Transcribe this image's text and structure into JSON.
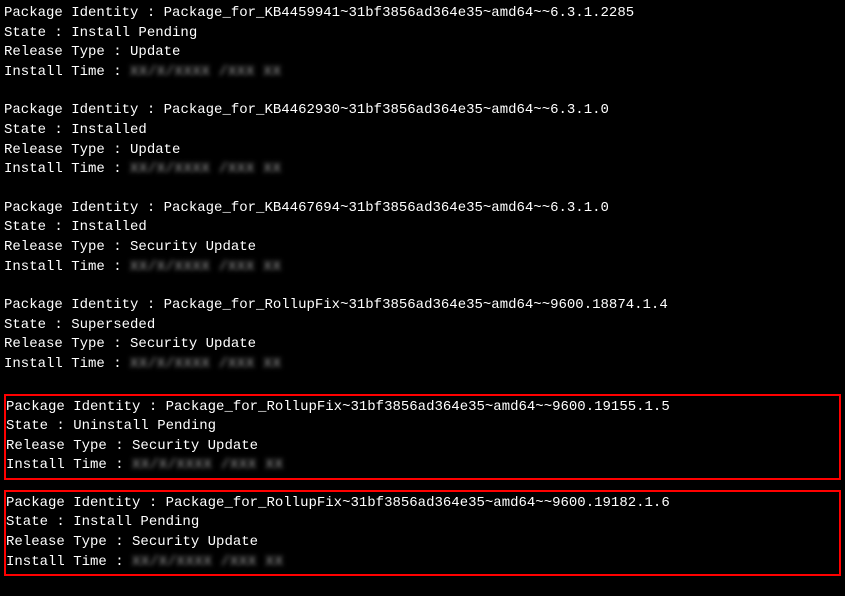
{
  "packages": [
    {
      "identity": "Package_for_KB4459941~31bf3856ad364e35~amd64~~6.3.1.2285",
      "state": "Install Pending",
      "releaseType": "Update",
      "installTime": "XX/X/XXXX /XXX XX",
      "highlighted": false
    },
    {
      "identity": "Package_for_KB4462930~31bf3856ad364e35~amd64~~6.3.1.0",
      "state": "Installed",
      "releaseType": "Update",
      "installTime": "XX/X/XXXX /XXX XX",
      "highlighted": false
    },
    {
      "identity": "Package_for_KB4467694~31bf3856ad364e35~amd64~~6.3.1.0",
      "state": "Installed",
      "releaseType": "Security Update",
      "installTime": "XX/X/XXXX /XXX XX",
      "highlighted": false
    },
    {
      "identity": "Package_for_RollupFix~31bf3856ad364e35~amd64~~9600.18874.1.4",
      "state": "Superseded",
      "releaseType": "Security Update",
      "installTime": "XX/X/XXXX /XXX XX",
      "highlighted": false
    },
    {
      "identity": "Package_for_RollupFix~31bf3856ad364e35~amd64~~9600.19155.1.5",
      "state": "Uninstall Pending",
      "releaseType": "Security Update",
      "installTime": "XX/X/XXXX /XXX XX",
      "highlighted": true
    },
    {
      "identity": "Package_for_RollupFix~31bf3856ad364e35~amd64~~9600.19182.1.6",
      "state": "Install Pending",
      "releaseType": "Security Update",
      "installTime": "XX/X/XXXX /XXX XX",
      "highlighted": true
    }
  ],
  "labels": {
    "identity": "Package Identity : ",
    "state": "State : ",
    "releaseType": "Release Type : ",
    "installTime": "Install Time : "
  }
}
